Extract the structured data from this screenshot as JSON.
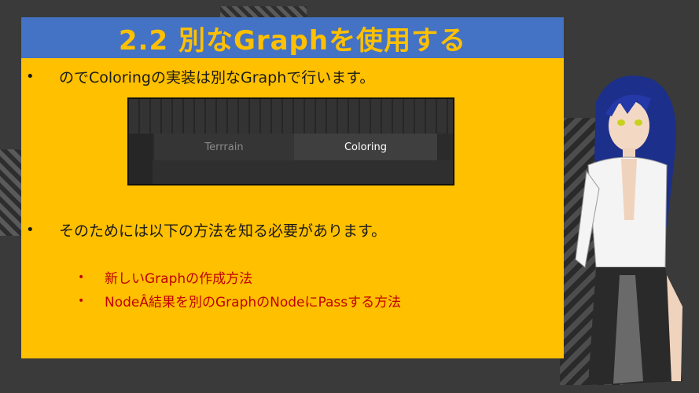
{
  "slide": {
    "title": "2.2 別なGraphを使用する",
    "bullets": [
      "のでColoringの実装は別なGraphで行います。",
      "そのためには以下の方法を知る必要があります。"
    ],
    "sub_bullets": [
      "新しいGraphの作成方法",
      "NodeÂ結果を別のGraphのNodeにPassする方法"
    ],
    "bullet_mark": "•"
  },
  "screenshot": {
    "tabs": [
      "Terrrain",
      "Coloring"
    ],
    "active_tab": "Coloring"
  },
  "colors": {
    "slide_bg": "#ffc000",
    "title_bar": "#4472c4",
    "sub_text": "#c00000"
  }
}
